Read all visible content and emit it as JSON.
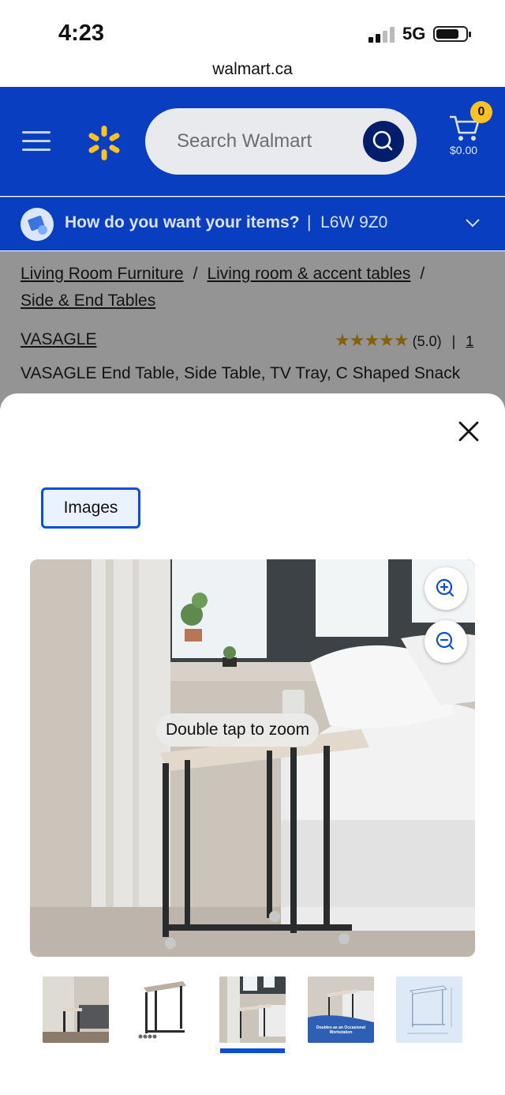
{
  "status_bar": {
    "time": "4:23",
    "network": "5G"
  },
  "browser": {
    "url": "walmart.ca"
  },
  "header": {
    "search_placeholder": "Search Walmart",
    "cart_count": "0",
    "cart_total": "$0.00"
  },
  "delivery": {
    "question": "How do you want your items?",
    "postal_code": "L6W 9Z0"
  },
  "breadcrumbs": [
    "Living Room Furniture",
    "Living room & accent tables",
    "Side & End Tables"
  ],
  "product": {
    "brand": "VASAGLE",
    "rating_stars": 5,
    "rating": "(5.0)",
    "review_count": "1",
    "title": "VASAGLE End Table, Side Table, TV Tray, C Shaped Snack"
  },
  "gallery": {
    "tab_label": "Images",
    "zoom_hint": "Double tap to zoom",
    "selected_index": 2,
    "thumb_caption_4": "Doubles as an Occasional Workstation"
  },
  "colors": {
    "header_blue": "#0a3ec0",
    "spark_yellow": "#ffc220",
    "accent_blue": "#0a4fd6"
  }
}
